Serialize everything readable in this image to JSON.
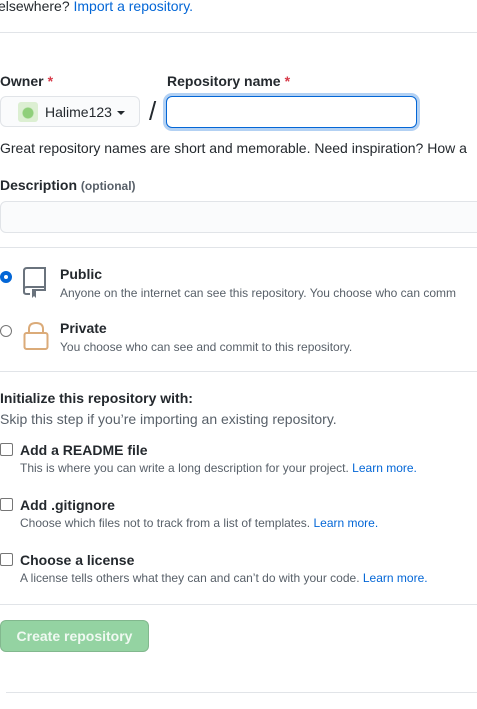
{
  "import": {
    "prefix": "elsewhere?",
    "link": "Import a repository."
  },
  "owner": {
    "label": "Owner",
    "required_mark": "*",
    "value": "Halime123"
  },
  "repo_name": {
    "label": "Repository name",
    "required_mark": "*",
    "value": "",
    "placeholder": ""
  },
  "hint_text": "Great repository names are short and memorable. Need inspiration? How a",
  "description": {
    "label": "Description",
    "optional": "(optional)",
    "value": ""
  },
  "visibility": {
    "public": {
      "title": "Public",
      "desc": "Anyone on the internet can see this repository. You choose who can comm",
      "selected": true
    },
    "private": {
      "title": "Private",
      "desc": "You choose who can see and commit to this repository.",
      "selected": false
    }
  },
  "init": {
    "heading": "Initialize this repository with:",
    "subtext": "Skip this step if you’re importing an existing repository.",
    "options": [
      {
        "label": "Add a README file",
        "desc": "This is where you can write a long description for your project.",
        "link": "Learn more.",
        "checked": false
      },
      {
        "label": "Add .gitignore",
        "desc": "Choose which files not to track from a list of templates.",
        "link": "Learn more.",
        "checked": false
      },
      {
        "label": "Choose a license",
        "desc": "A license tells others what they can and can’t do with your code.",
        "link": "Learn more.",
        "checked": false
      }
    ]
  },
  "create_button": "Create repository",
  "colors": {
    "primary_disabled": "#94d3a2",
    "link": "#0366d6",
    "required": "#d73a49",
    "border": "#e1e4e8"
  }
}
